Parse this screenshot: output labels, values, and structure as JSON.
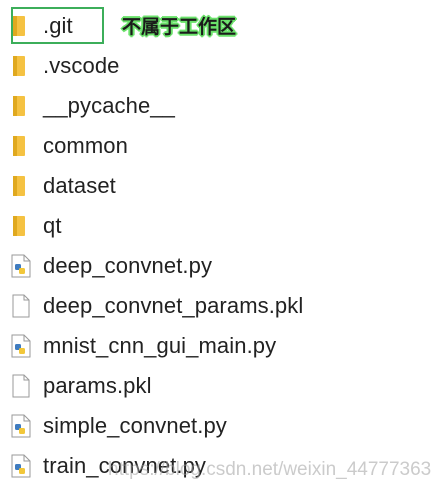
{
  "annotation": "不属于工作区",
  "watermark": "https://blog.csdn.net/weixin_44777363",
  "colors": {
    "highlight_border": "#3cae5a",
    "annotation_glow": "#6be26b",
    "folder": "#f5c242",
    "file_border": "#9a9a9a"
  },
  "files": [
    {
      "name": ".git",
      "icon": "folder-icon"
    },
    {
      "name": ".vscode",
      "icon": "folder-icon"
    },
    {
      "name": "__pycache__",
      "icon": "folder-icon"
    },
    {
      "name": "common",
      "icon": "folder-icon"
    },
    {
      "name": "dataset",
      "icon": "folder-icon"
    },
    {
      "name": "qt",
      "icon": "folder-icon"
    },
    {
      "name": "deep_convnet.py",
      "icon": "python-file-icon"
    },
    {
      "name": "deep_convnet_params.pkl",
      "icon": "blank-file-icon"
    },
    {
      "name": "mnist_cnn_gui_main.py",
      "icon": "python-file-icon"
    },
    {
      "name": "params.pkl",
      "icon": "blank-file-icon"
    },
    {
      "name": "simple_convnet.py",
      "icon": "python-file-icon"
    },
    {
      "name": "train_convnet.py",
      "icon": "python-file-icon"
    }
  ]
}
